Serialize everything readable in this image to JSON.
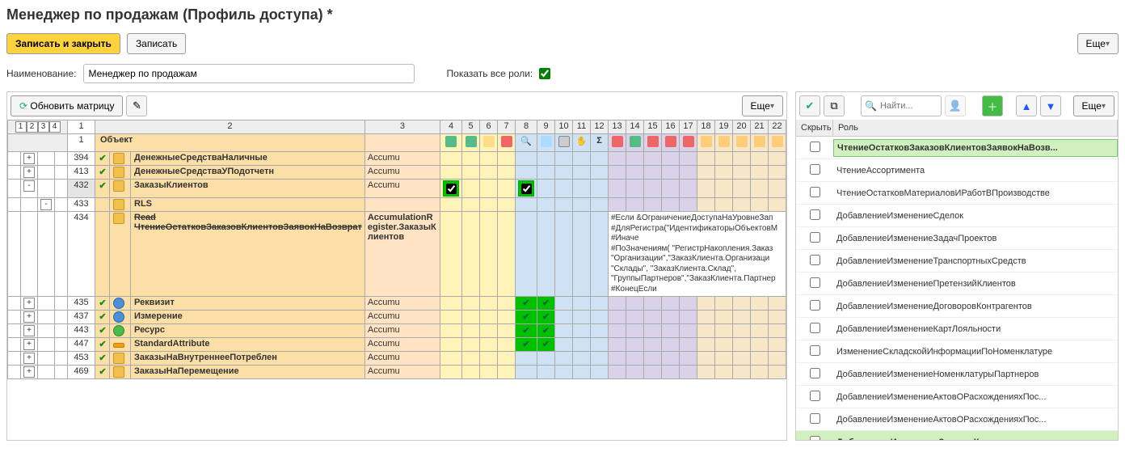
{
  "title": "Менеджер по продажам (Профиль доступа) *",
  "buttons": {
    "save_close": "Записать и закрыть",
    "save": "Записать",
    "more": "Еще",
    "update_matrix": "Обновить матрицу"
  },
  "form": {
    "name_label": "Наименование:",
    "name_value": "Менеджер по продажам",
    "show_all_roles_label": "Показать все роли:"
  },
  "col_headers": {
    "idx": "1",
    "obj": "Объект",
    "c2": "2",
    "c3": "3"
  },
  "col_nums": [
    "4",
    "5",
    "6",
    "7",
    "8",
    "9",
    "10",
    "11",
    "12",
    "13",
    "14",
    "15",
    "16",
    "17",
    "18",
    "19",
    "20",
    "21",
    "22"
  ],
  "level_tabs": [
    "1",
    "2",
    "3",
    "4"
  ],
  "rows": [
    {
      "n": "394",
      "obj": "ДенежныеСредстваНаличные",
      "c3": "Accumu",
      "tree": "+",
      "chk": true,
      "icon": "yellow"
    },
    {
      "n": "413",
      "obj": "ДенежныеСредстваУПодотчетн",
      "c3": "Accumu",
      "tree": "+",
      "chk": true,
      "icon": "yellow"
    },
    {
      "n": "432",
      "obj": "ЗаказыКлиентов",
      "c3": "Accumu",
      "tree": "-",
      "chk": true,
      "icon": "yellow",
      "boxes": true,
      "sel": true
    },
    {
      "n": "433",
      "obj": "RLS",
      "c3": "",
      "tree2": "-",
      "icon": "yellow"
    },
    {
      "n": "434",
      "obj": "Read\nЧтениеОстатковЗаказовКлиентовЗаявокНаВозврат",
      "c3": "AccumulationRegister.ЗаказыКлиентов",
      "icon": "yellow",
      "strike": true,
      "script": true
    },
    {
      "n": "435",
      "obj": "Реквизит",
      "c3": "Accumu",
      "tree": "+",
      "chk": true,
      "icon": "blue",
      "dbl": true
    },
    {
      "n": "437",
      "obj": "Измерение",
      "c3": "Accumu",
      "tree": "+",
      "chk": true,
      "icon": "blue",
      "dbl": true
    },
    {
      "n": "443",
      "obj": "Ресурс",
      "c3": "Accumu",
      "tree": "+",
      "chk": true,
      "icon": "green",
      "dbl": true
    },
    {
      "n": "447",
      "obj": "StandardAttribute",
      "c3": "Accumu",
      "tree": "+",
      "chk": true,
      "icon": "orange",
      "dbl": true
    },
    {
      "n": "453",
      "obj": "ЗаказыНаВнутреннееПотреблен",
      "c3": "Accumu",
      "tree": "+",
      "chk": true,
      "icon": "yellow"
    },
    {
      "n": "469",
      "obj": "ЗаказыНаПеремещение",
      "c3": "Accumu",
      "tree": "+",
      "chk": true,
      "icon": "yellow"
    }
  ],
  "script_text": "#Если &ОграничениеДоступаНаУровнеЗап\n#ДляРегистра(\"ИдентификаторыОбъектовМ\n#Иначе\n#ПоЗначениям( \"РегистрНакопления.Заказ\n\"Организации\",\"ЗаказКлиента.Организаци\n\"Склады\", \"ЗаказКлиента.Склад\",\n\"ГруппыПартнеров\",\"ЗаказКлиента.Партнер\n#КонецЕсли",
  "right": {
    "hide": "Скрыть",
    "role": "Роль",
    "search": "Найти...",
    "roles": [
      {
        "name": "ЧтениеОстатковЗаказовКлиентовЗаявокНаВозв...",
        "hl": true
      },
      {
        "name": "ЧтениеАссортимента"
      },
      {
        "name": "ЧтениеОстатковМатериаловИРаботВПроизводстве"
      },
      {
        "name": "ДобавлениеИзменениеСделок"
      },
      {
        "name": "ДобавлениеИзменениеЗадачПроектов"
      },
      {
        "name": "ДобавлениеИзменениеТранспортныхСредств"
      },
      {
        "name": "ДобавлениеИзменениеПретензийКлиентов"
      },
      {
        "name": "ДобавлениеИзменениеДоговоровКонтрагентов"
      },
      {
        "name": "ДобавлениеИзменениеКартЛояльности"
      },
      {
        "name": "ИзменениеСкладскойИнформацииПоНоменклатуре"
      },
      {
        "name": "ДобавлениеИзменениеНоменклатурыПартнеров"
      },
      {
        "name": "ДобавлениеИзменениеАктовОРасхожденияхПос..."
      },
      {
        "name": "ДобавлениеИзменениеАктовОРасхожденияхПос..."
      },
      {
        "name": "ДобавлениеИзменениеЗаказовКлиентов",
        "hl2": true
      }
    ]
  }
}
